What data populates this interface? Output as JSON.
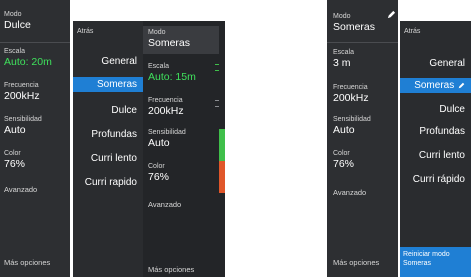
{
  "left_screen": {
    "sidebar": {
      "modo": {
        "label": "Modo",
        "value": "Dulce"
      },
      "escala": {
        "label": "Escala",
        "value": "Auto: 20m"
      },
      "frecuencia": {
        "label": "Frecuencia",
        "value": "200kHz"
      },
      "sensibilidad": {
        "label": "Sensibilidad",
        "value": "Auto"
      },
      "color": {
        "label": "Color",
        "value": "76%"
      },
      "avanzado": "Avanzado",
      "mas_opciones": "Más opciones"
    },
    "menu": {
      "atras": "Atrás",
      "items": [
        "General",
        "Someras",
        "Dulce",
        "Profundas",
        "Curri lento",
        "Curri rapido"
      ],
      "selected_index": 1
    },
    "overlay_sidebar": {
      "modo": {
        "label": "Modo",
        "value": "Someras"
      },
      "escala": {
        "label": "Escala",
        "value": "Auto: 15m"
      },
      "frecuencia": {
        "label": "Frecuencia",
        "value": "200kHz"
      },
      "sensibilidad": {
        "label": "Sensibilidad",
        "value": "Auto"
      },
      "color": {
        "label": "Color",
        "value": "76%"
      },
      "avanzado": "Avanzado",
      "mas_opciones": "Más opciones"
    }
  },
  "right_screen": {
    "sidebar": {
      "modo": {
        "label": "Modo",
        "value": "Someras"
      },
      "escala": {
        "label": "Escala",
        "value": "3 m"
      },
      "frecuencia": {
        "label": "Frecuencia",
        "value": "200kHz"
      },
      "sensibilidad": {
        "label": "Sensibilidad",
        "value": "Auto"
      },
      "color": {
        "label": "Color",
        "value": "76%"
      },
      "avanzado": "Avanzado",
      "mas_opciones": "Más opciones"
    },
    "menu": {
      "atras": "Atrás",
      "items": [
        "General",
        "Someras",
        "Dulce",
        "Profundas",
        "Curri lento",
        "Curri rápido"
      ],
      "selected_index": 1,
      "reset_button": "Reiniciar modo Someras"
    }
  },
  "colors": {
    "panel": "#2d2f32",
    "selected": "#1f7fd4",
    "green_value": "#3fe05c",
    "orange_accent": "#e0562a",
    "green_accent": "#3fbf4a"
  }
}
